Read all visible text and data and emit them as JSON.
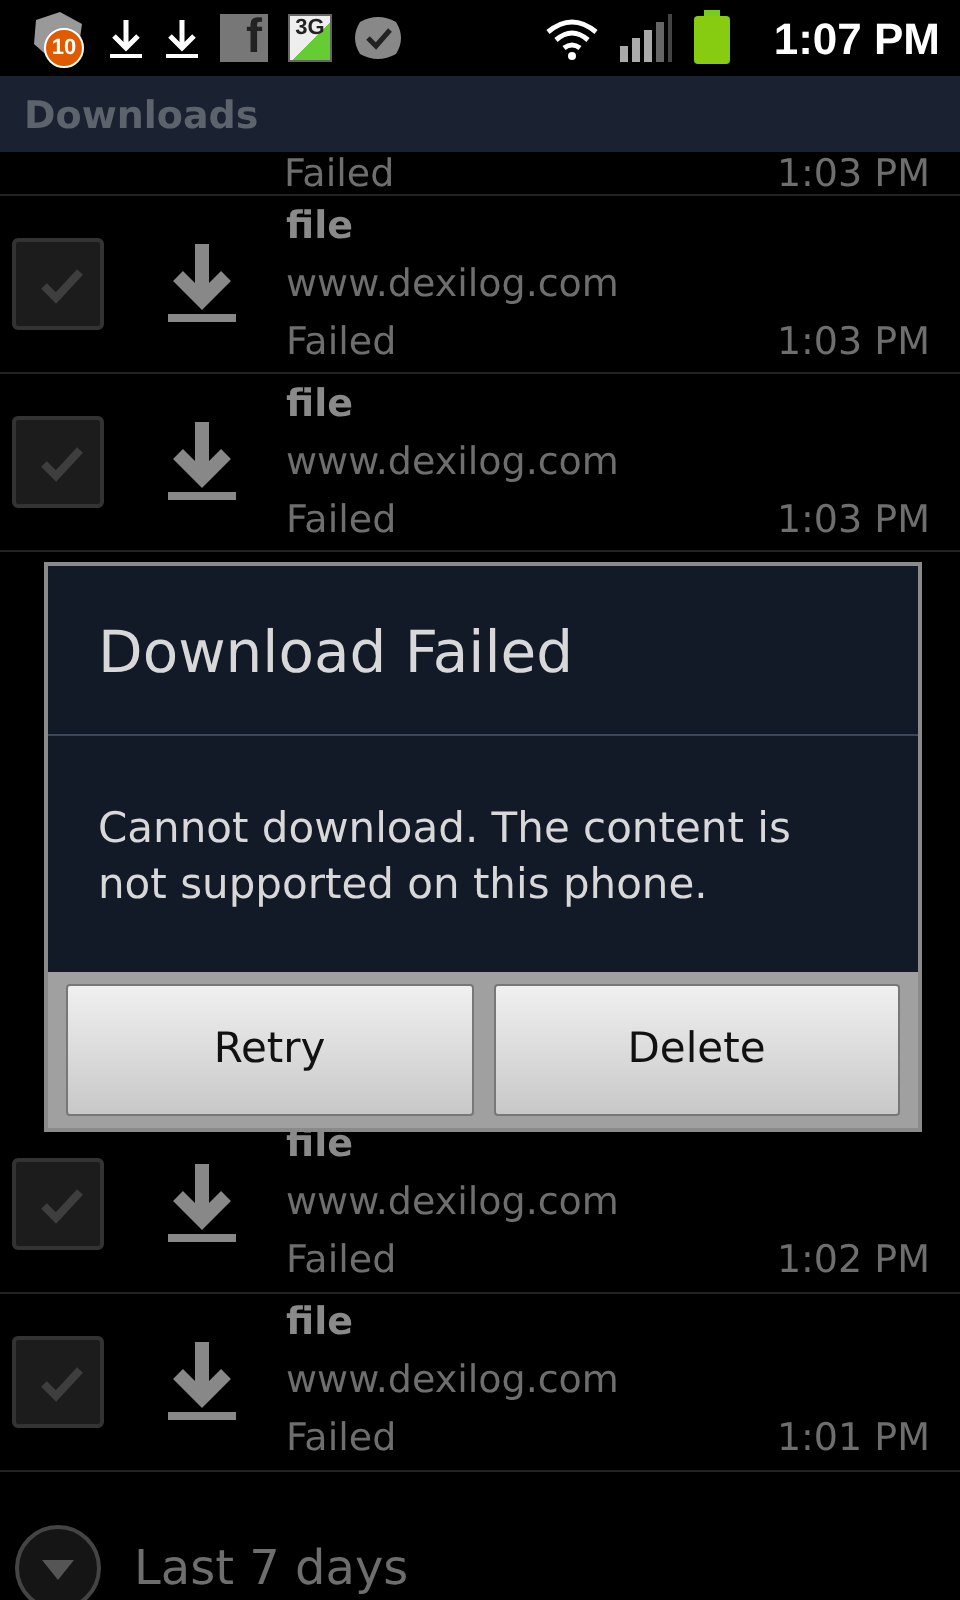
{
  "status_bar": {
    "notification_count": "10",
    "facebook_glyph": "f",
    "network_label": "3G",
    "time": "1:07 PM"
  },
  "title_bar": {
    "title": "Downloads"
  },
  "downloads": [
    {
      "status": "Failed",
      "time": "1:03 PM"
    },
    {
      "checked": false,
      "name": "file",
      "url": "www.dexilog.com",
      "status": "Failed",
      "time": "1:03 PM"
    },
    {
      "checked": false,
      "name": "file",
      "url": "www.dexilog.com",
      "status": "Failed",
      "time": "1:03 PM"
    },
    {
      "checked": false,
      "name": "file",
      "url": "www.dexilog.com",
      "status": "Failed",
      "time": "1:02 PM"
    },
    {
      "checked": false,
      "name": "file",
      "url": "www.dexilog.com",
      "status": "Failed",
      "time": "1:01 PM"
    }
  ],
  "group_header": {
    "label": "Last 7 days",
    "expanded": false
  },
  "dialog": {
    "title": "Download Failed",
    "message": "Cannot download. The content is not supported on this phone.",
    "buttons": [
      "Retry",
      "Delete"
    ]
  }
}
